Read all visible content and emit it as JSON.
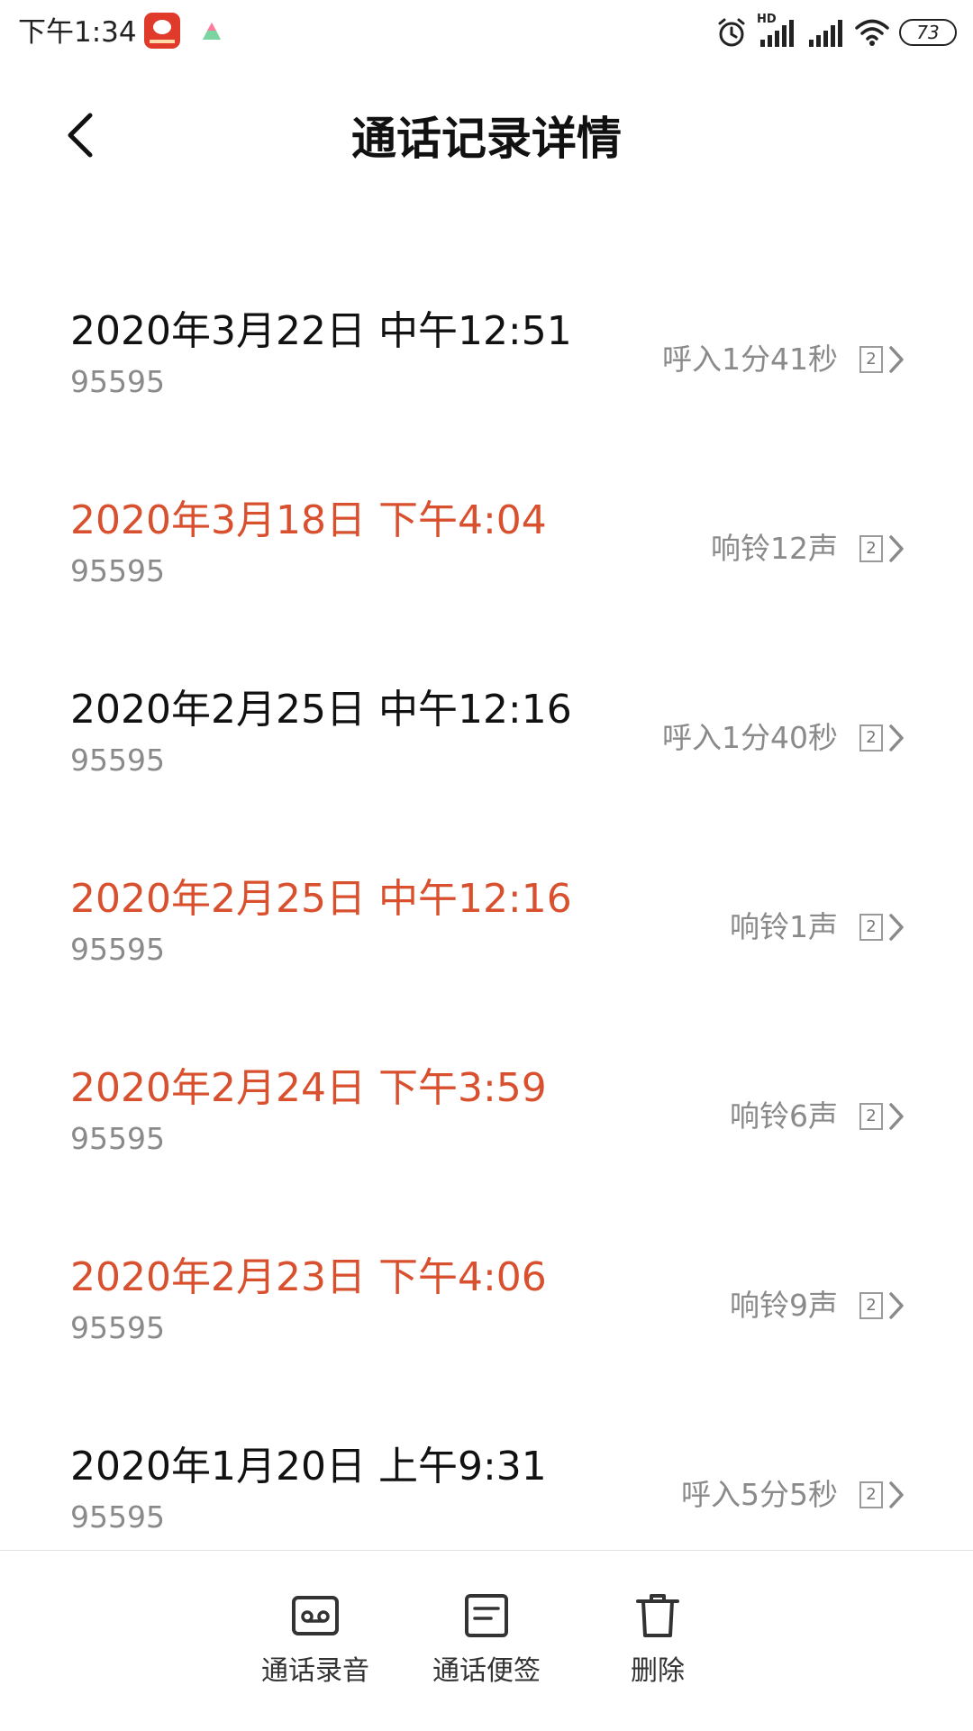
{
  "status_bar": {
    "time": "下午1:34",
    "network_label": "HD",
    "battery": "73",
    "icons": [
      "app-badge-icon",
      "assistant-icon",
      "alarm-icon",
      "hd-signal-icon",
      "signal-icon",
      "wifi-icon",
      "battery-icon"
    ]
  },
  "header": {
    "title": "通话记录详情",
    "back_icon": "chevron-left-icon"
  },
  "records": [
    {
      "datetime": "2020年3月22日 中午12:51",
      "number": "95595",
      "status": "呼入1分41秒",
      "sim": "2",
      "missed": false
    },
    {
      "datetime": "2020年3月18日 下午4:04",
      "number": "95595",
      "status": "响铃12声",
      "sim": "2",
      "missed": true
    },
    {
      "datetime": "2020年2月25日 中午12:16",
      "number": "95595",
      "status": "呼入1分40秒",
      "sim": "2",
      "missed": false
    },
    {
      "datetime": "2020年2月25日 中午12:16",
      "number": "95595",
      "status": "响铃1声",
      "sim": "2",
      "missed": true
    },
    {
      "datetime": "2020年2月24日 下午3:59",
      "number": "95595",
      "status": "响铃6声",
      "sim": "2",
      "missed": true
    },
    {
      "datetime": "2020年2月23日 下午4:06",
      "number": "95595",
      "status": "响铃9声",
      "sim": "2",
      "missed": true
    },
    {
      "datetime": "2020年1月20日 上午9:31",
      "number": "95595",
      "status": "呼入5分5秒",
      "sim": "2",
      "missed": false
    }
  ],
  "bottom_bar": {
    "recording_label": "通话录音",
    "notes_label": "通话便签",
    "delete_label": "删除",
    "icons": [
      "cassette-icon",
      "note-icon",
      "trash-icon"
    ]
  },
  "colors": {
    "missed_call": "#d9502e",
    "normal_text": "#111111",
    "secondary_text": "#8a8a8a",
    "background": "#ffffff"
  }
}
